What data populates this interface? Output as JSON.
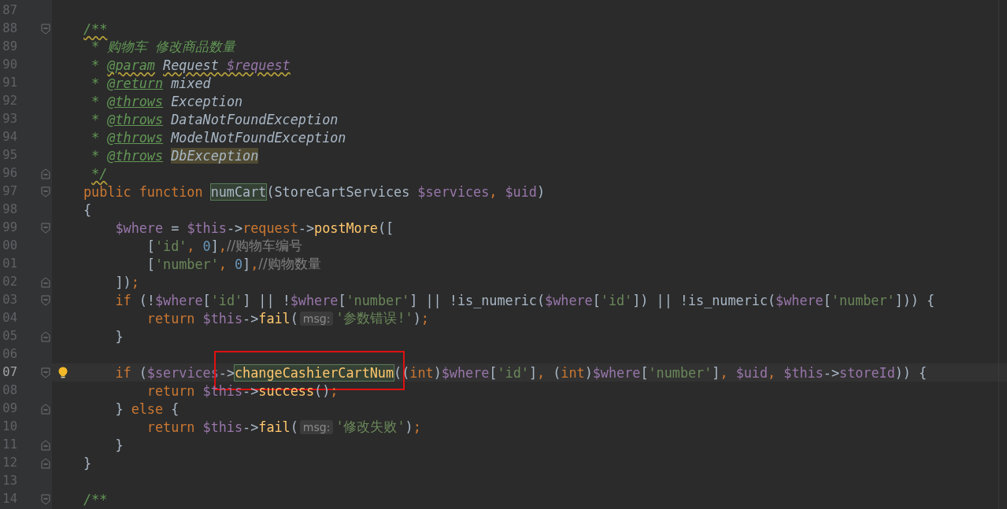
{
  "editor": {
    "lines": [
      {
        "number": "87",
        "current": false,
        "fold_open": false,
        "fold_close": false
      },
      {
        "number": "88",
        "current": false,
        "fold_open": true,
        "fold_close": false,
        "tokens": [
          {
            "kind": "doc",
            "t": "/**",
            "squiggle": true
          }
        ]
      },
      {
        "number": "89",
        "current": false,
        "fold_open": false,
        "fold_close": false,
        "tokens": [
          {
            "kind": "doc",
            "t": " * 购物车 修改商品数量"
          }
        ]
      },
      {
        "number": "90",
        "current": false,
        "fold_open": false,
        "fold_close": false,
        "tokens": [
          {
            "kind": "doc",
            "t": " * "
          },
          {
            "kind": "doctag",
            "t": "@param",
            "squiggle": true
          },
          {
            "kind": "doctype",
            "t": " Request ",
            "squiggle": true
          },
          {
            "kind": "docvar",
            "t": "$request",
            "squiggle": true
          }
        ]
      },
      {
        "number": "91",
        "current": false,
        "fold_open": false,
        "fold_close": false,
        "tokens": [
          {
            "kind": "doc",
            "t": " * "
          },
          {
            "kind": "doctag",
            "t": "@return"
          },
          {
            "kind": "doctype",
            "t": " mixed"
          }
        ]
      },
      {
        "number": "92",
        "current": false,
        "fold_open": false,
        "fold_close": false,
        "tokens": [
          {
            "kind": "doc",
            "t": " * "
          },
          {
            "kind": "doctag",
            "t": "@throws"
          },
          {
            "kind": "doctype",
            "t": " Exception"
          }
        ]
      },
      {
        "number": "93",
        "current": false,
        "fold_open": false,
        "fold_close": false,
        "tokens": [
          {
            "kind": "doc",
            "t": " * "
          },
          {
            "kind": "doctag",
            "t": "@throws"
          },
          {
            "kind": "doctype",
            "t": " DataNotFoundException"
          }
        ]
      },
      {
        "number": "94",
        "current": false,
        "fold_open": false,
        "fold_close": false,
        "tokens": [
          {
            "kind": "doc",
            "t": " * "
          },
          {
            "kind": "doctag",
            "t": "@throws"
          },
          {
            "kind": "doctype",
            "t": " ModelNotFoundException"
          }
        ]
      },
      {
        "number": "95",
        "current": false,
        "fold_open": false,
        "fold_close": false,
        "tokens": [
          {
            "kind": "doc",
            "t": " * "
          },
          {
            "kind": "doctag",
            "t": "@throws"
          },
          {
            "kind": "doctype",
            "t": " DbException",
            "warning": true
          }
        ]
      },
      {
        "number": "96",
        "current": false,
        "fold_open": false,
        "fold_close": true,
        "tokens": [
          {
            "kind": "doc",
            "t": " */",
            "squiggle": true
          }
        ]
      },
      {
        "number": "97",
        "current": false,
        "fold_open": true,
        "fold_close": false,
        "tokens": [
          {
            "kind": "kw",
            "t": "public function "
          },
          {
            "kind": "plain",
            "t": "numCart",
            "match": true
          },
          {
            "kind": "plain",
            "t": "(StoreCartServices "
          },
          {
            "kind": "var",
            "t": "$services"
          },
          {
            "kind": "kw",
            "t": ", "
          },
          {
            "kind": "var",
            "t": "$uid"
          },
          {
            "kind": "plain",
            "t": ")"
          }
        ]
      },
      {
        "number": "98",
        "current": false,
        "fold_open": false,
        "fold_close": false,
        "tokens": [
          {
            "kind": "plain",
            "t": "{"
          }
        ]
      },
      {
        "number": "99",
        "current": false,
        "fold_open": true,
        "fold_close": false,
        "tokens": [
          {
            "kind": "var",
            "t": "    $where"
          },
          {
            "kind": "plain",
            "t": " = "
          },
          {
            "kind": "var",
            "t": "$this"
          },
          {
            "kind": "plain",
            "t": "->"
          },
          {
            "kind": "field",
            "t": "request"
          },
          {
            "kind": "plain",
            "t": "->"
          },
          {
            "kind": "fn",
            "t": "postMore"
          },
          {
            "kind": "plain",
            "t": "(["
          }
        ]
      },
      {
        "number": "00",
        "current": false,
        "fold_open": false,
        "fold_close": false,
        "tokens": [
          {
            "kind": "plain",
            "t": "        ["
          },
          {
            "kind": "str",
            "t": "'id'"
          },
          {
            "kind": "kw",
            "t": ", "
          },
          {
            "kind": "num",
            "t": "0"
          },
          {
            "kind": "plain",
            "t": "]"
          },
          {
            "kind": "kw",
            "t": ","
          },
          {
            "kind": "comment",
            "t": "//购物车编号"
          }
        ]
      },
      {
        "number": "01",
        "current": false,
        "fold_open": false,
        "fold_close": false,
        "tokens": [
          {
            "kind": "plain",
            "t": "        ["
          },
          {
            "kind": "str",
            "t": "'number'"
          },
          {
            "kind": "kw",
            "t": ", "
          },
          {
            "kind": "num",
            "t": "0"
          },
          {
            "kind": "plain",
            "t": "]"
          },
          {
            "kind": "kw",
            "t": ","
          },
          {
            "kind": "comment",
            "t": "//购物数量"
          }
        ]
      },
      {
        "number": "02",
        "current": false,
        "fold_open": false,
        "fold_close": true,
        "tokens": [
          {
            "kind": "plain",
            "t": "    ])"
          },
          {
            "kind": "kw",
            "t": ";"
          }
        ]
      },
      {
        "number": "03",
        "current": false,
        "fold_open": true,
        "fold_close": false,
        "tokens": [
          {
            "kind": "kw",
            "t": "    if"
          },
          {
            "kind": "plain",
            "t": " (!"
          },
          {
            "kind": "var",
            "t": "$where"
          },
          {
            "kind": "plain",
            "t": "["
          },
          {
            "kind": "str",
            "t": "'id'"
          },
          {
            "kind": "plain",
            "t": "] || !"
          },
          {
            "kind": "var",
            "t": "$where"
          },
          {
            "kind": "plain",
            "t": "["
          },
          {
            "kind": "str",
            "t": "'number'"
          },
          {
            "kind": "plain",
            "t": "] || !is_numeric("
          },
          {
            "kind": "var",
            "t": "$where"
          },
          {
            "kind": "plain",
            "t": "["
          },
          {
            "kind": "str",
            "t": "'id'"
          },
          {
            "kind": "plain",
            "t": "]) || !is_numeric("
          },
          {
            "kind": "var",
            "t": "$where"
          },
          {
            "kind": "plain",
            "t": "["
          },
          {
            "kind": "str",
            "t": "'number'"
          },
          {
            "kind": "plain",
            "t": "])) {"
          }
        ]
      },
      {
        "number": "04",
        "current": false,
        "fold_open": false,
        "fold_close": false,
        "tokens": [
          {
            "kind": "kw",
            "t": "        return "
          },
          {
            "kind": "var",
            "t": "$this"
          },
          {
            "kind": "plain",
            "t": "->"
          },
          {
            "kind": "fn",
            "t": "fail"
          },
          {
            "kind": "plain",
            "t": "("
          },
          {
            "kind": "hint",
            "t": "msg:"
          },
          {
            "kind": "str",
            "t": "'参数错误!'"
          },
          {
            "kind": "plain",
            "t": ")"
          },
          {
            "kind": "kw",
            "t": ";"
          }
        ]
      },
      {
        "number": "05",
        "current": false,
        "fold_open": false,
        "fold_close": true,
        "tokens": [
          {
            "kind": "plain",
            "t": "    }"
          }
        ]
      },
      {
        "number": "06",
        "current": false,
        "fold_open": false,
        "fold_close": false
      },
      {
        "number": "07",
        "current": true,
        "fold_open": true,
        "fold_close": false,
        "tokens": [
          {
            "kind": "kw",
            "t": "    if"
          },
          {
            "kind": "plain",
            "t": " ("
          },
          {
            "kind": "var",
            "t": "$services"
          },
          {
            "kind": "plain",
            "t": "->"
          },
          {
            "kind": "fn",
            "t": "changeCashierCartNum",
            "match": true,
            "boxed": true
          },
          {
            "kind": "plain",
            "t": "(("
          },
          {
            "kind": "kw",
            "t": "int"
          },
          {
            "kind": "plain",
            "t": ")"
          },
          {
            "kind": "var",
            "t": "$where"
          },
          {
            "kind": "plain",
            "t": "["
          },
          {
            "kind": "str",
            "t": "'id'"
          },
          {
            "kind": "plain",
            "t": "]"
          },
          {
            "kind": "kw",
            "t": ", "
          },
          {
            "kind": "plain",
            "t": "("
          },
          {
            "kind": "kw",
            "t": "int"
          },
          {
            "kind": "plain",
            "t": ")"
          },
          {
            "kind": "var",
            "t": "$where"
          },
          {
            "kind": "plain",
            "t": "["
          },
          {
            "kind": "str",
            "t": "'number'"
          },
          {
            "kind": "plain",
            "t": "]"
          },
          {
            "kind": "kw",
            "t": ", "
          },
          {
            "kind": "var",
            "t": "$uid"
          },
          {
            "kind": "kw",
            "t": ", "
          },
          {
            "kind": "var",
            "t": "$this"
          },
          {
            "kind": "plain",
            "t": "->"
          },
          {
            "kind": "var",
            "t": "storeId"
          },
          {
            "kind": "plain",
            "t": ")) {"
          }
        ]
      },
      {
        "number": "08",
        "current": false,
        "fold_open": false,
        "fold_close": false,
        "tokens": [
          {
            "kind": "kw",
            "t": "        return "
          },
          {
            "kind": "var",
            "t": "$this"
          },
          {
            "kind": "plain",
            "t": "->"
          },
          {
            "kind": "fn",
            "t": "success"
          },
          {
            "kind": "plain",
            "t": "()"
          },
          {
            "kind": "kw",
            "t": ";"
          }
        ]
      },
      {
        "number": "09",
        "current": false,
        "fold_open": false,
        "fold_close": true,
        "tokens": [
          {
            "kind": "plain",
            "t": "    } "
          },
          {
            "kind": "kw",
            "t": "else"
          },
          {
            "kind": "plain",
            "t": " {"
          }
        ]
      },
      {
        "number": "10",
        "current": false,
        "fold_open": false,
        "fold_close": false,
        "tokens": [
          {
            "kind": "kw",
            "t": "        return "
          },
          {
            "kind": "var",
            "t": "$this"
          },
          {
            "kind": "plain",
            "t": "->"
          },
          {
            "kind": "fn",
            "t": "fail"
          },
          {
            "kind": "plain",
            "t": "("
          },
          {
            "kind": "hint",
            "t": "msg:"
          },
          {
            "kind": "str",
            "t": "'修改失败'"
          },
          {
            "kind": "plain",
            "t": ")"
          },
          {
            "kind": "kw",
            "t": ";"
          }
        ]
      },
      {
        "number": "11",
        "current": false,
        "fold_open": false,
        "fold_close": true,
        "tokens": [
          {
            "kind": "plain",
            "t": "    }"
          }
        ]
      },
      {
        "number": "12",
        "current": false,
        "fold_open": false,
        "fold_close": true,
        "tokens": [
          {
            "kind": "plain",
            "t": "}"
          }
        ]
      },
      {
        "number": "13",
        "current": false,
        "fold_open": false,
        "fold_close": false
      },
      {
        "number": "14",
        "current": false,
        "fold_open": true,
        "fold_close": false,
        "tokens": [
          {
            "kind": "doc",
            "t": "/**"
          }
        ]
      }
    ]
  }
}
